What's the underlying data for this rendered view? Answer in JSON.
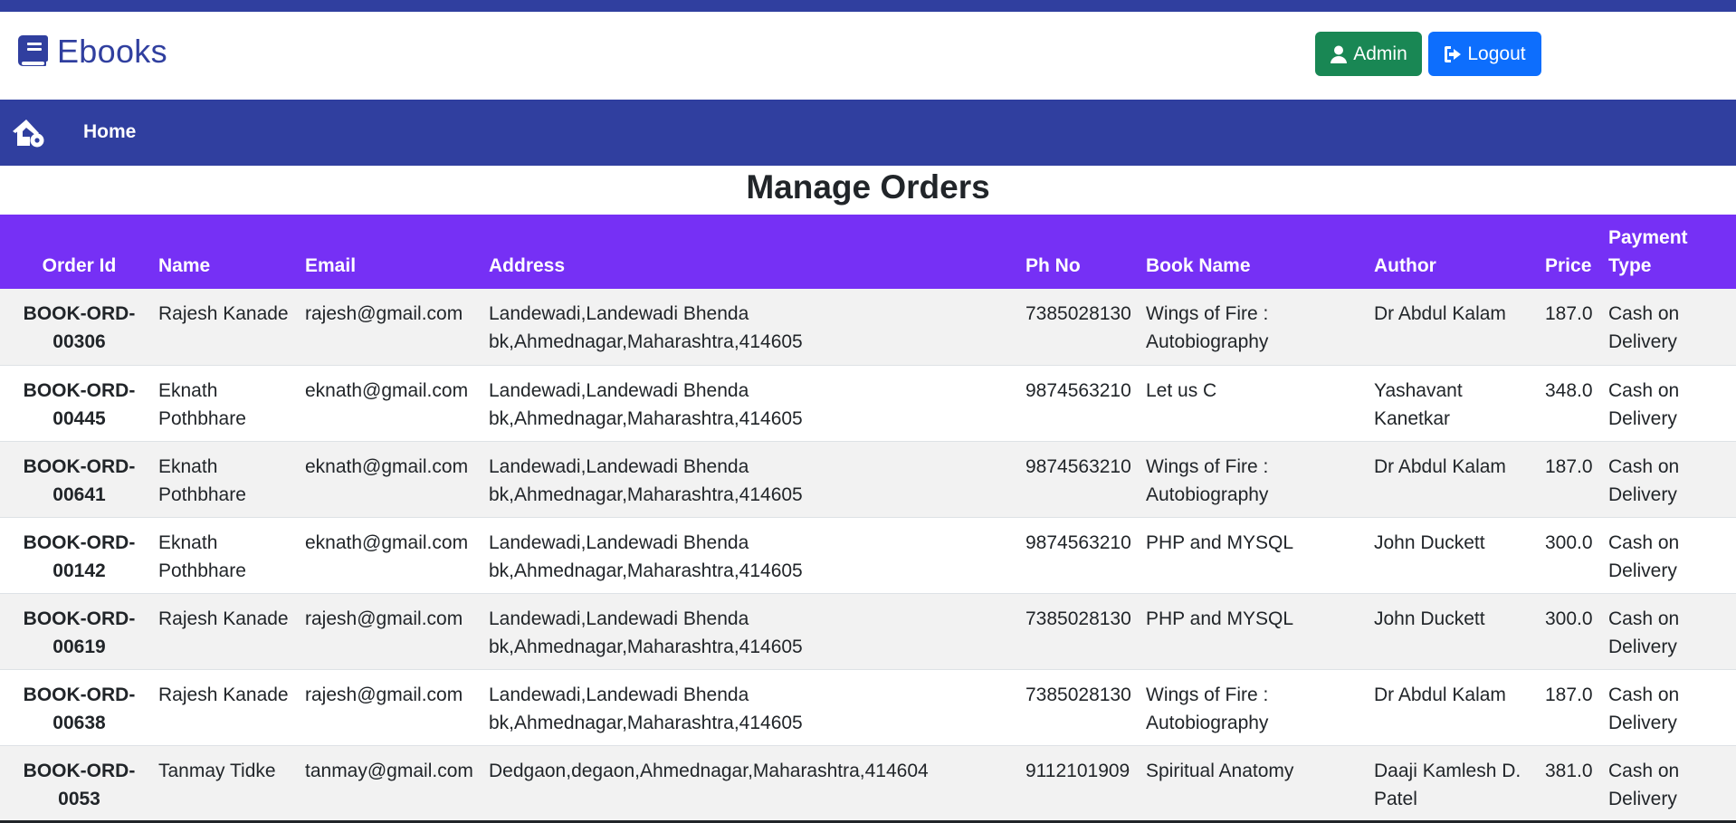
{
  "brand": {
    "name": "Ebooks",
    "icon": "book-icon",
    "color": "#303f9f"
  },
  "header": {
    "admin_label": "Admin",
    "logout_label": "Logout",
    "admin_color": "#198754",
    "logout_color": "#0d6efd"
  },
  "nav": {
    "home_icon": "home-gear-icon",
    "home_label": "Home",
    "color": "#303f9f"
  },
  "page": {
    "title": "Manage Orders"
  },
  "table": {
    "header_color": "#7630f5",
    "columns": {
      "order_id": "Order Id",
      "name": "Name",
      "email": "Email",
      "address": "Address",
      "phone": "Ph No",
      "book_name": "Book Name",
      "author": "Author",
      "price": "Price",
      "payment_line1": "Payment",
      "payment_line2": "Type"
    },
    "rows": [
      {
        "order_id": "BOOK-ORD-00306",
        "name": "Rajesh Kanade",
        "email": "rajesh@gmail.com",
        "address": "Landewadi,Landewadi Bhenda bk,Ahmednagar,Maharashtra,414605",
        "phone": "7385028130",
        "book_name": "Wings of Fire : Autobiography",
        "author": "Dr Abdul Kalam",
        "price": "187.0",
        "payment": "Cash on Delivery"
      },
      {
        "order_id": "BOOK-ORD-00445",
        "name": "Eknath Pothbhare",
        "email": "eknath@gmail.com",
        "address": "Landewadi,Landewadi Bhenda bk,Ahmednagar,Maharashtra,414605",
        "phone": "9874563210",
        "book_name": "Let us C",
        "author": "Yashavant Kanetkar",
        "price": "348.0",
        "payment": "Cash on Delivery"
      },
      {
        "order_id": "BOOK-ORD-00641",
        "name": "Eknath Pothbhare",
        "email": "eknath@gmail.com",
        "address": "Landewadi,Landewadi Bhenda bk,Ahmednagar,Maharashtra,414605",
        "phone": "9874563210",
        "book_name": "Wings of Fire : Autobiography",
        "author": "Dr Abdul Kalam",
        "price": "187.0",
        "payment": "Cash on Delivery"
      },
      {
        "order_id": "BOOK-ORD-00142",
        "name": "Eknath Pothbhare",
        "email": "eknath@gmail.com",
        "address": "Landewadi,Landewadi Bhenda bk,Ahmednagar,Maharashtra,414605",
        "phone": "9874563210",
        "book_name": "PHP and MYSQL",
        "author": "John Duckett",
        "price": "300.0",
        "payment": "Cash on Delivery"
      },
      {
        "order_id": "BOOK-ORD-00619",
        "name": "Rajesh Kanade",
        "email": "rajesh@gmail.com",
        "address": "Landewadi,Landewadi Bhenda bk,Ahmednagar,Maharashtra,414605",
        "phone": "7385028130",
        "book_name": "PHP and MYSQL",
        "author": "John Duckett",
        "price": "300.0",
        "payment": "Cash on Delivery"
      },
      {
        "order_id": "BOOK-ORD-00638",
        "name": "Rajesh Kanade",
        "email": "rajesh@gmail.com",
        "address": "Landewadi,Landewadi Bhenda bk,Ahmednagar,Maharashtra,414605",
        "phone": "7385028130",
        "book_name": "Wings of Fire : Autobiography",
        "author": "Dr Abdul Kalam",
        "price": "187.0",
        "payment": "Cash on Delivery"
      },
      {
        "order_id": "BOOK-ORD-0053",
        "name": "Tanmay Tidke",
        "email": "tanmay@gmail.com",
        "address": "Dedgaon,degaon,Ahmednagar,Maharashtra,414604",
        "phone": "9112101909",
        "book_name": "Spiritual Anatomy",
        "author": "Daaji Kamlesh D. Patel",
        "price": "381.0",
        "payment": "Cash on Delivery"
      }
    ]
  }
}
